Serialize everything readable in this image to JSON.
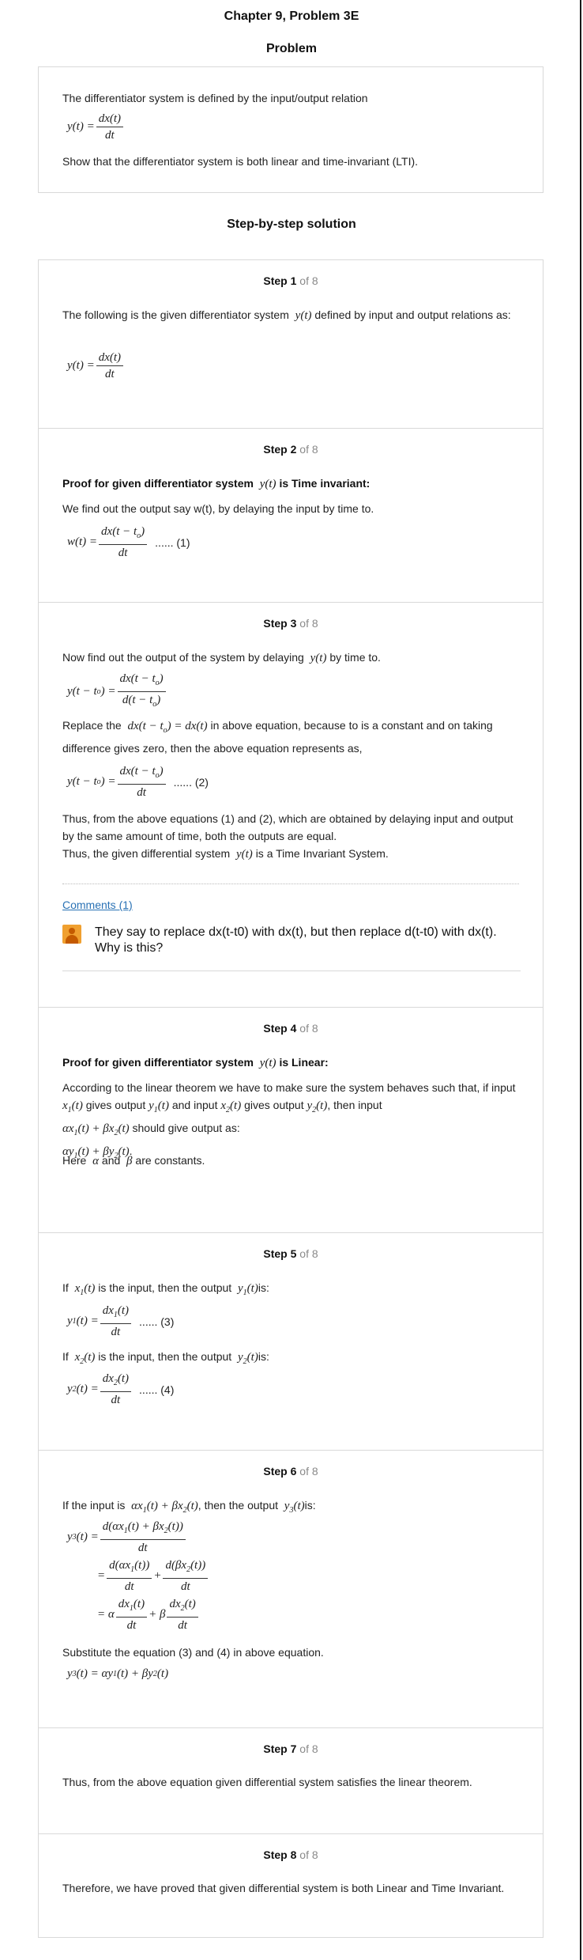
{
  "chapter_title": "Chapter 9, Problem 3E",
  "problem": {
    "heading": "Problem",
    "line1": "The differentiator system is defined by the input/output relation",
    "line2": "Show that the differentiator system is both linear and time-invariant (LTI)."
  },
  "solution_heading": "Step-by-step solution",
  "step_label": "Step",
  "of_total": "of 8",
  "steps": [
    {
      "number": "1",
      "text": "The following is the given differentiator system",
      "text_b": "defined by input and output relations as:"
    },
    {
      "number": "2",
      "title": "Proof for given differentiator system",
      "title_b": "is Time invariant:",
      "text": "We find out the output say w(t), by delaying the input by time to.",
      "tag": "...... (1)"
    },
    {
      "number": "3",
      "text1": "Now find out the output of the system by delaying",
      "text1_b": "by time to.",
      "text2a": "Replace the",
      "text2b": "in above equation, because to is a constant and on taking difference gives zero, then the above equation represents as,",
      "tag": "...... (2)",
      "text3": "Thus, from the above equations (1) and (2), which are obtained by delaying input and output by the same amount of time, both the outputs are equal.",
      "text4a": "Thus, the given differential system",
      "text4b": "is a Time Invariant System.",
      "comments_link": "Comments (1)",
      "comment": "They say to replace dx(t-t0) with dx(t), but then replace d(t-t0) with dx(t). Why is this?"
    },
    {
      "number": "4",
      "title": "Proof for given differentiator system",
      "title_b": "is Linear:",
      "text1": "According to the linear theorem we have to make sure the system behaves such that, if input",
      "text1_b": "gives output",
      "text1_c": "and input",
      "text1_d": "gives output",
      "text1_e": ", then input",
      "text1_f": "should give output as:",
      "text2a": "Here",
      "text2b": "and",
      "text2c": "are constants."
    },
    {
      "number": "5",
      "text1a": "If",
      "text1b": "is the input, then the output",
      "text1c": "is:",
      "tag1": "...... (3)",
      "tag2": "...... (4)"
    },
    {
      "number": "6",
      "text1a": "If the input is",
      "text1b": ", then the output",
      "text1c": "is:",
      "text2": "Substitute the equation (3) and (4) in above equation."
    },
    {
      "number": "7",
      "text": "Thus, from the above equation given differential system satisfies the linear theorem."
    },
    {
      "number": "8",
      "text": "Therefore, we have proved that given differential system is both Linear and Time Invariant."
    }
  ]
}
